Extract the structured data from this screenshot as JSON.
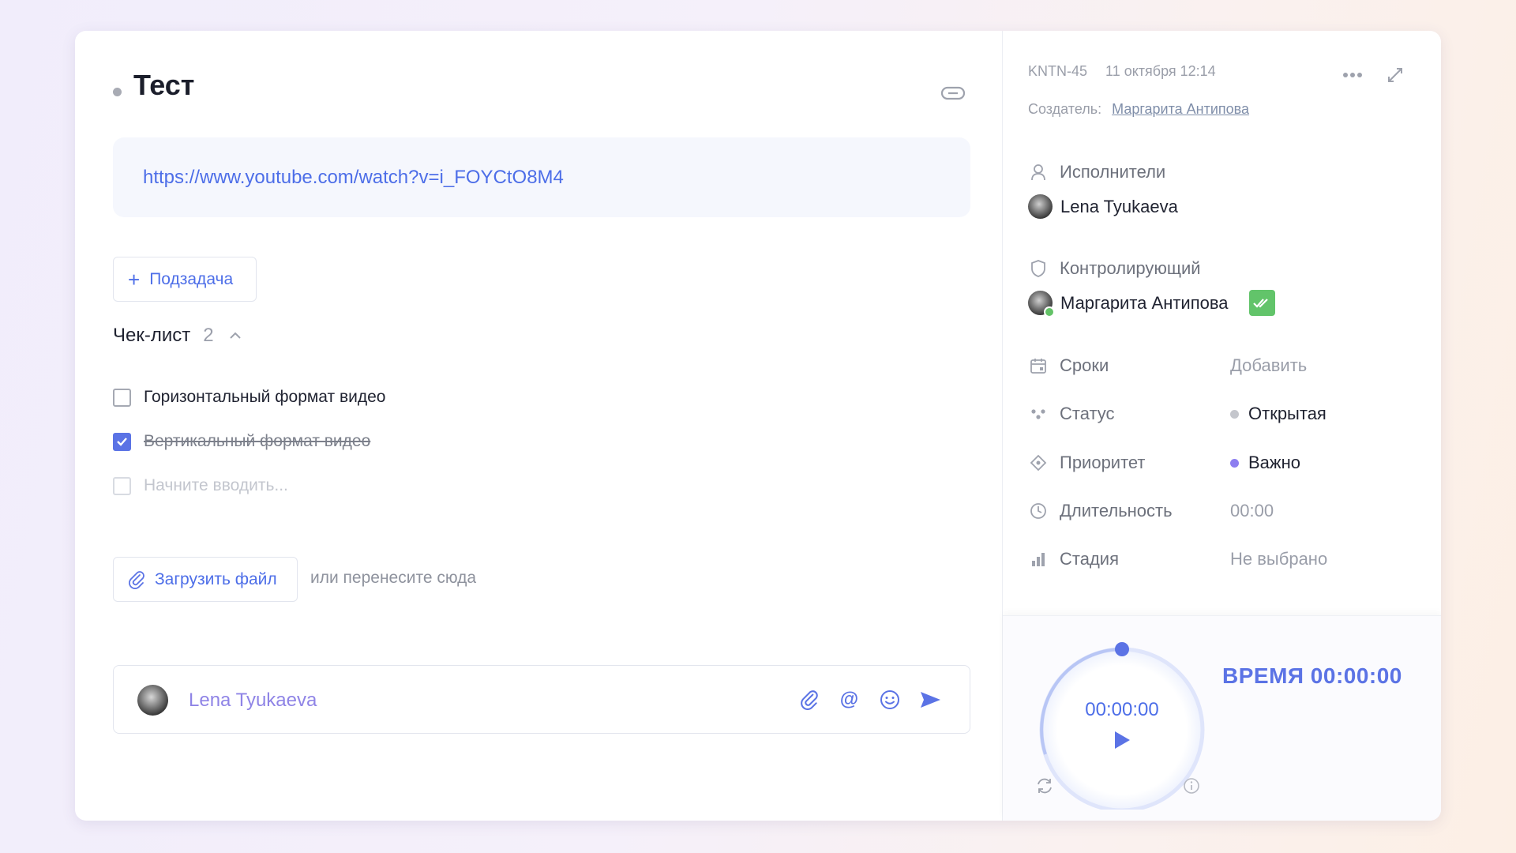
{
  "task": {
    "title": "Тест",
    "description_link": "https://www.youtube.com/watch?v=i_FOYCtO8M4"
  },
  "subtask_button": {
    "label": "Подзадача"
  },
  "checklist": {
    "title": "Чек-лист",
    "count": "2",
    "items": [
      {
        "label": "Горизонтальный формат видео",
        "checked": false
      },
      {
        "label": "Вертикальный формат видео",
        "checked": true
      }
    ],
    "new_item_placeholder": "Начните вводить..."
  },
  "upload": {
    "button_label": "Загрузить файл",
    "hint": "или перенесите сюда"
  },
  "comment": {
    "author": "Lena Tyukaeva",
    "mention_symbol": "@"
  },
  "sidebar": {
    "task_id": "KNTN-45",
    "created_at": "11 октября 12:14",
    "creator_label": "Создатель:",
    "creator_name": "Маргарита Антипова",
    "assignees_label": "Исполнители",
    "assignee_name": "Lena Tyukaeva",
    "controller_label": "Контролирующий",
    "controller_name": "Маргарита Антипова",
    "properties": {
      "deadline": {
        "label": "Сроки",
        "value": "Добавить"
      },
      "status": {
        "label": "Статус",
        "value": "Открытая",
        "dot_color": "#c4c6cc"
      },
      "priority": {
        "label": "Приоритет",
        "value": "Важно",
        "dot_color": "#8d7ef0"
      },
      "duration": {
        "label": "Длительность",
        "value": "00:00"
      },
      "stage": {
        "label": "Стадия",
        "value": "Не выбрано"
      }
    }
  },
  "timer": {
    "display": "00:00:00",
    "time_label": "ВРЕМЯ 00:00:00"
  },
  "colors": {
    "accent": "#5b73e5",
    "link": "#4d6ee8",
    "approve_green": "#62c46a"
  },
  "icons": [
    "link-icon",
    "more-icon",
    "expand-icon",
    "user-icon",
    "shield-icon",
    "calendar-icon",
    "status-icon",
    "priority-icon",
    "clock-icon",
    "stage-icon",
    "paperclip-icon",
    "at-icon",
    "emoji-icon",
    "send-icon",
    "play-icon",
    "reset-icon",
    "info-icon",
    "check-icon",
    "chevron-up-icon",
    "plus-icon"
  ]
}
